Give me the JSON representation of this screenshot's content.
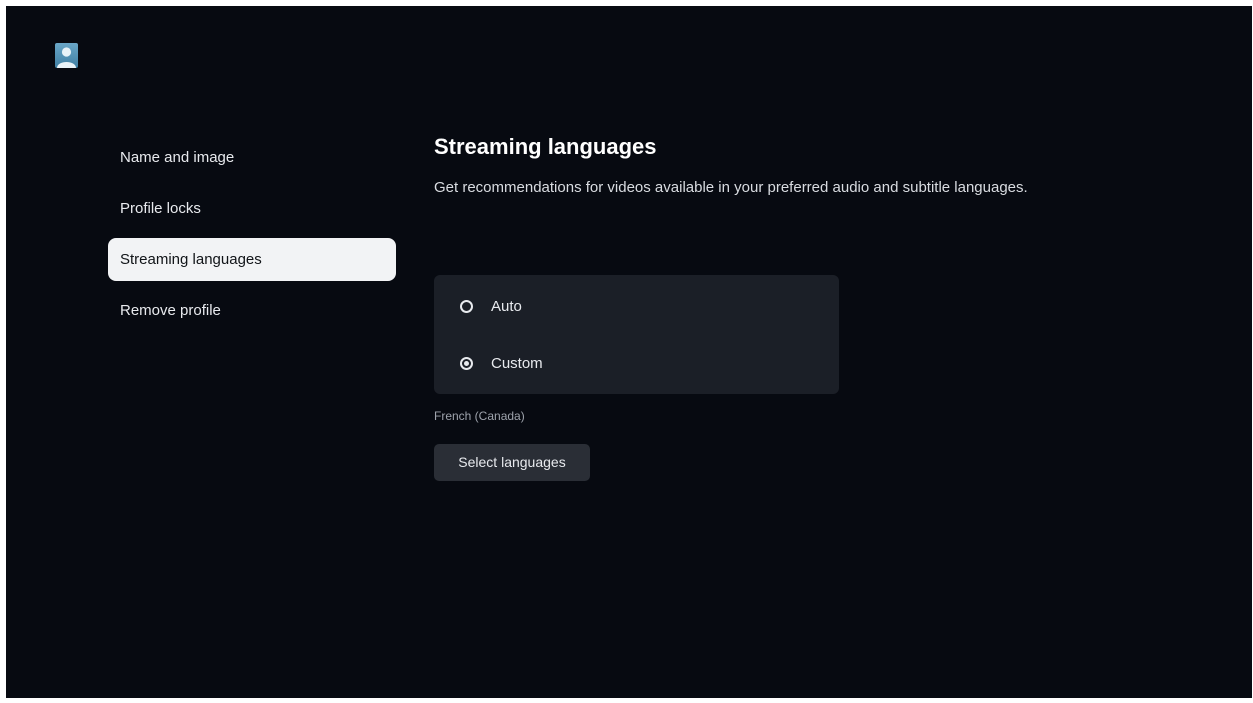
{
  "header": {
    "avatar_icon": "user-avatar-icon"
  },
  "sidebar": {
    "items": [
      {
        "label": "Name and image"
      },
      {
        "label": "Profile locks"
      },
      {
        "label": "Streaming languages"
      },
      {
        "label": "Remove profile"
      }
    ],
    "selected_index": 2
  },
  "main": {
    "title": "Streaming languages",
    "description": "Get recommendations for videos available in your preferred audio and subtitle languages.",
    "options": [
      {
        "label": "Auto",
        "selected": false
      },
      {
        "label": "Custom",
        "selected": true
      }
    ],
    "selected_language": "French (Canada)",
    "select_button_label": "Select languages"
  },
  "colors": {
    "background": "#070a11",
    "selected_item_bg": "#f2f3f5",
    "panel_bg": "#1b1f27",
    "button_bg": "#2a2e36"
  }
}
